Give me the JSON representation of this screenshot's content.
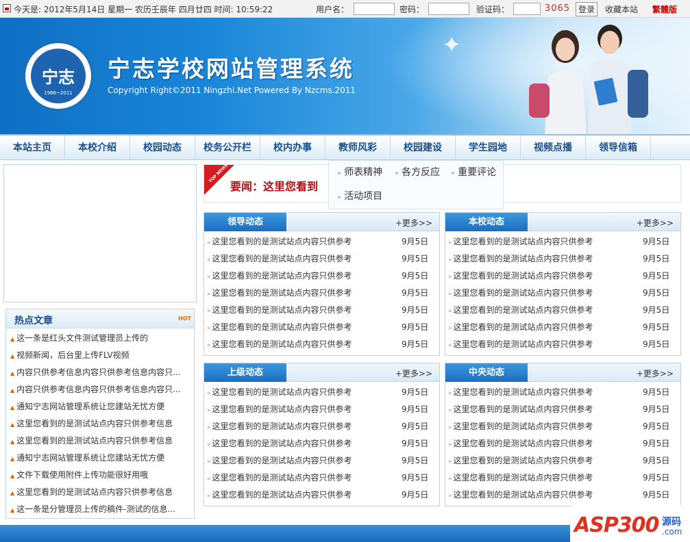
{
  "topbar": {
    "date_text": "今天是: 2012年5月14日 星期一 农历壬辰年 四月廿四 时间: 10:59:22",
    "username_label": "用户名：",
    "password_label": "密码：",
    "captcha_label": "验证码：",
    "captcha_code": "3065",
    "login_button": "登录",
    "bookmark_link": "收藏本站",
    "traditional_link": "繁體版"
  },
  "banner": {
    "title": "宁志学校网站管理系统",
    "copyright": "Copyright Right©2011 Ningzhi.Net Powered By Nzcms.2011",
    "logo_text": "宁志",
    "logo_year": "1986~2011"
  },
  "nav": {
    "items": [
      "本站主页",
      "本校介绍",
      "校园动态",
      "校务公开栏",
      "校内办事",
      "教师风彩",
      "校园建设",
      "学生园地",
      "视频点播",
      "领导信箱"
    ]
  },
  "submenu": {
    "items": [
      "师表精神",
      "各方反应",
      "重要评论",
      "活动项目"
    ]
  },
  "hot": {
    "title": "热点文章",
    "hot_label": "HOT",
    "items": [
      "这一条是红头文件测试管理员上传的",
      "视频新闻，后台里上传FLV视频",
      "内容只供参考信息内容只供参考信息内容只...",
      "内容只供参考信息内容只供参考信息内容只...",
      "通知宁志网站管理系统让您建站无忧方便",
      "这里您看到的是测试站点内容只供参考信息",
      "这里您看到的是测试站点内容只供参考信息",
      "通知宁志网站管理系统让您建站无忧方便",
      "文件下载使用附件上传功能很好用哦",
      "这里您看到的是测试站点内容只供参考信息",
      "这一条是分管理员上传的稿件-测试的信息..."
    ]
  },
  "news": {
    "badge": "TOP NEWS",
    "headline": "要闻：这里您看到"
  },
  "panels": [
    {
      "title": "领导动态",
      "more": "+更多>>",
      "rows": [
        "这里您看到的是测试站点内容只供参考",
        "这里您看到的是测试站点内容只供参考",
        "这里您看到的是测试站点内容只供参考",
        "这里您看到的是测试站点内容只供参考",
        "这里您看到的是测试站点内容只供参考",
        "这里您看到的是测试站点内容只供参考",
        "这里您看到的是测试站点内容只供参考"
      ],
      "date": "9月5日"
    },
    {
      "title": "本校动态",
      "more": "+更多>>",
      "rows": [
        "这里您看到的是测试站点内容只供参考",
        "这里您看到的是测试站点内容只供参考",
        "这里您看到的是测试站点内容只供参考",
        "这里您看到的是测试站点内容只供参考",
        "这里您看到的是测试站点内容只供参考",
        "这里您看到的是测试站点内容只供参考",
        "这里您看到的是测试站点内容只供参考"
      ],
      "date": "9月5日"
    },
    {
      "title": "上级动态",
      "more": "+更多>>",
      "rows": [
        "这里您看到的是测试站点内容只供参考",
        "这里您看到的是测试站点内容只供参考",
        "这里您看到的是测试站点内容只供参考",
        "这里您看到的是测试站点内容只供参考",
        "这里您看到的是测试站点内容只供参考",
        "这里您看到的是测试站点内容只供参考",
        "这里您看到的是测试站点内容只供参考"
      ],
      "date": "9月5日"
    },
    {
      "title": "中央动态",
      "more": "+更多>>",
      "rows": [
        "这里您看到的是测试站点内容只供参考",
        "这里您看到的是测试站点内容只供参考",
        "这里您看到的是测试站点内容只供参考",
        "这里您看到的是测试站点内容只供参考",
        "这里您看到的是测试站点内容只供参考",
        "这里您看到的是测试站点内容只供参考",
        "这里您看到的是测试站点内容只供参考"
      ],
      "date": "9月5日"
    }
  ],
  "watermark": {
    "brand": "ASP300",
    "sub1": "源码",
    "sub2": ".com"
  }
}
